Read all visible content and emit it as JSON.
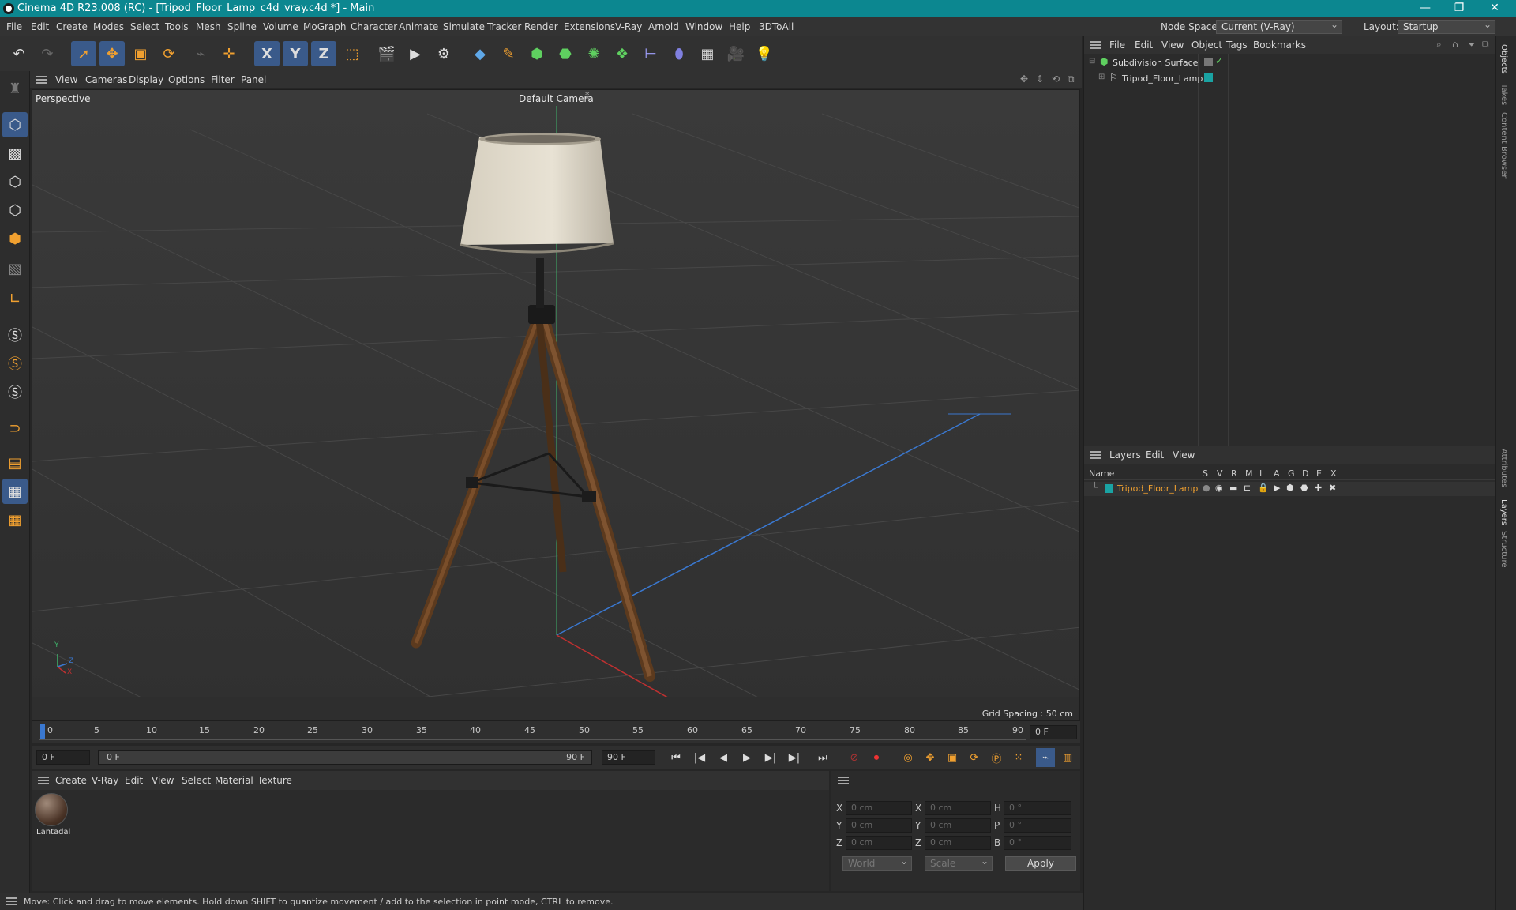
{
  "window": {
    "title": "Cinema 4D R23.008 (RC) - [Tripod_Floor_Lamp_c4d_vray.c4d *] - Main",
    "min": "—",
    "restore": "❐",
    "close": "✕"
  },
  "menu": [
    "File",
    "Edit",
    "Create",
    "Modes",
    "Select",
    "Tools",
    "Mesh",
    "Spline",
    "Volume",
    "MoGraph",
    "Character",
    "Animate",
    "Simulate",
    "Tracker",
    "Render",
    "Extensions",
    "V-Ray",
    "Arnold",
    "Window",
    "Help",
    "3DToAll"
  ],
  "node_space": {
    "label": "Node Space:",
    "value": "Current (V-Ray)"
  },
  "layout": {
    "label": "Layout:",
    "value": "Startup"
  },
  "toolbar": {
    "x": "X",
    "y": "Y",
    "z": "Z"
  },
  "viewport": {
    "menu": [
      "View",
      "Cameras",
      "Display",
      "Options",
      "Filter",
      "Panel"
    ],
    "label": "Perspective",
    "camera": "Default Camera",
    "grid_spacing": "Grid Spacing : 50 cm",
    "axis_y": "Y",
    "axis_z": "Z",
    "axis_x": "X"
  },
  "timeline": {
    "ticks": [
      "0",
      "5",
      "10",
      "15",
      "20",
      "25",
      "30",
      "35",
      "40",
      "45",
      "50",
      "55",
      "60",
      "65",
      "70",
      "75",
      "80",
      "85",
      "90"
    ],
    "current": "0 F"
  },
  "transport": {
    "start": "0 F",
    "range_start": "0 F",
    "range_end": "90 F",
    "end": "90 F"
  },
  "material_menu": [
    "Create",
    "V-Ray",
    "Edit",
    "View",
    "Select",
    "Material",
    "Texture"
  ],
  "materials": [
    {
      "name": "Lantadal"
    }
  ],
  "coords": {
    "header": [
      "--",
      "--",
      "--"
    ],
    "rows": [
      {
        "a": "X",
        "av": "0 cm",
        "b": "X",
        "bv": "0 cm",
        "c": "H",
        "cv": "0 °"
      },
      {
        "a": "Y",
        "av": "0 cm",
        "b": "Y",
        "bv": "0 cm",
        "c": "P",
        "cv": "0 °"
      },
      {
        "a": "Z",
        "av": "0 cm",
        "b": "Z",
        "bv": "0 cm",
        "c": "B",
        "cv": "0 °"
      }
    ],
    "mode1": "World",
    "mode2": "Scale",
    "apply": "Apply"
  },
  "objects": {
    "menu": [
      "File",
      "Edit",
      "View",
      "Object",
      "Tags",
      "Bookmarks"
    ],
    "items": [
      {
        "name": "Subdivision Surface"
      },
      {
        "name": "Tripod_Floor_Lamp"
      }
    ]
  },
  "layers": {
    "menu": [
      "Layers",
      "Edit",
      "View"
    ],
    "header": "Name",
    "cols": [
      "S",
      "V",
      "R",
      "M",
      "L",
      "A",
      "G",
      "D",
      "E",
      "X"
    ],
    "items": [
      {
        "name": "Tripod_Floor_Lamp",
        "color": "#1aa3a3"
      }
    ]
  },
  "right_tabs": [
    "Objects",
    "Takes",
    "Content Browser",
    "Attributes",
    "Layers",
    "Structure"
  ],
  "status": "Move: Click and drag to move elements. Hold down SHIFT to quantize movement / add to the selection in point mode, CTRL to remove."
}
